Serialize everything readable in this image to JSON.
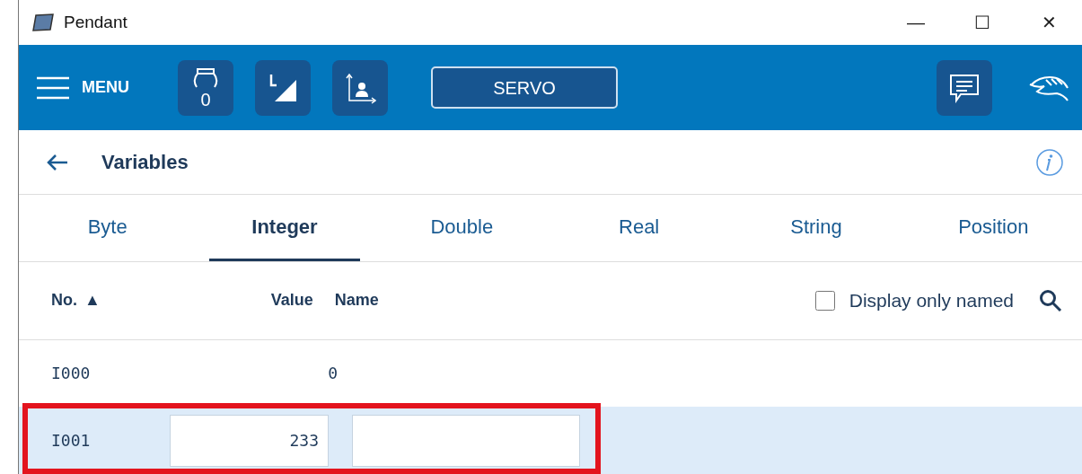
{
  "window": {
    "title": "Pendant",
    "controls": [
      "—",
      "☐",
      "✕"
    ]
  },
  "toolbar": {
    "menu_label": "MENU",
    "tool_counter": "0",
    "servo_label": "SERVO"
  },
  "header": {
    "title": "Variables"
  },
  "tabs": [
    {
      "label": "Byte",
      "selected": false
    },
    {
      "label": "Integer",
      "selected": true
    },
    {
      "label": "Double",
      "selected": false
    },
    {
      "label": "Real",
      "selected": false
    },
    {
      "label": "String",
      "selected": false
    },
    {
      "label": "Position",
      "selected": false
    }
  ],
  "table": {
    "columns": [
      {
        "label": "No.",
        "sort": "▲"
      },
      {
        "label": "Value"
      },
      {
        "label": "Name"
      }
    ],
    "filter": {
      "label": "Display only named",
      "checked": false
    },
    "rows": [
      {
        "no": "I000",
        "value": "0",
        "kind": "text",
        "selected": false,
        "highlighted": false
      },
      {
        "no": "I001",
        "value": "233",
        "kind": "edit",
        "selected": true,
        "highlighted": true
      }
    ]
  }
}
